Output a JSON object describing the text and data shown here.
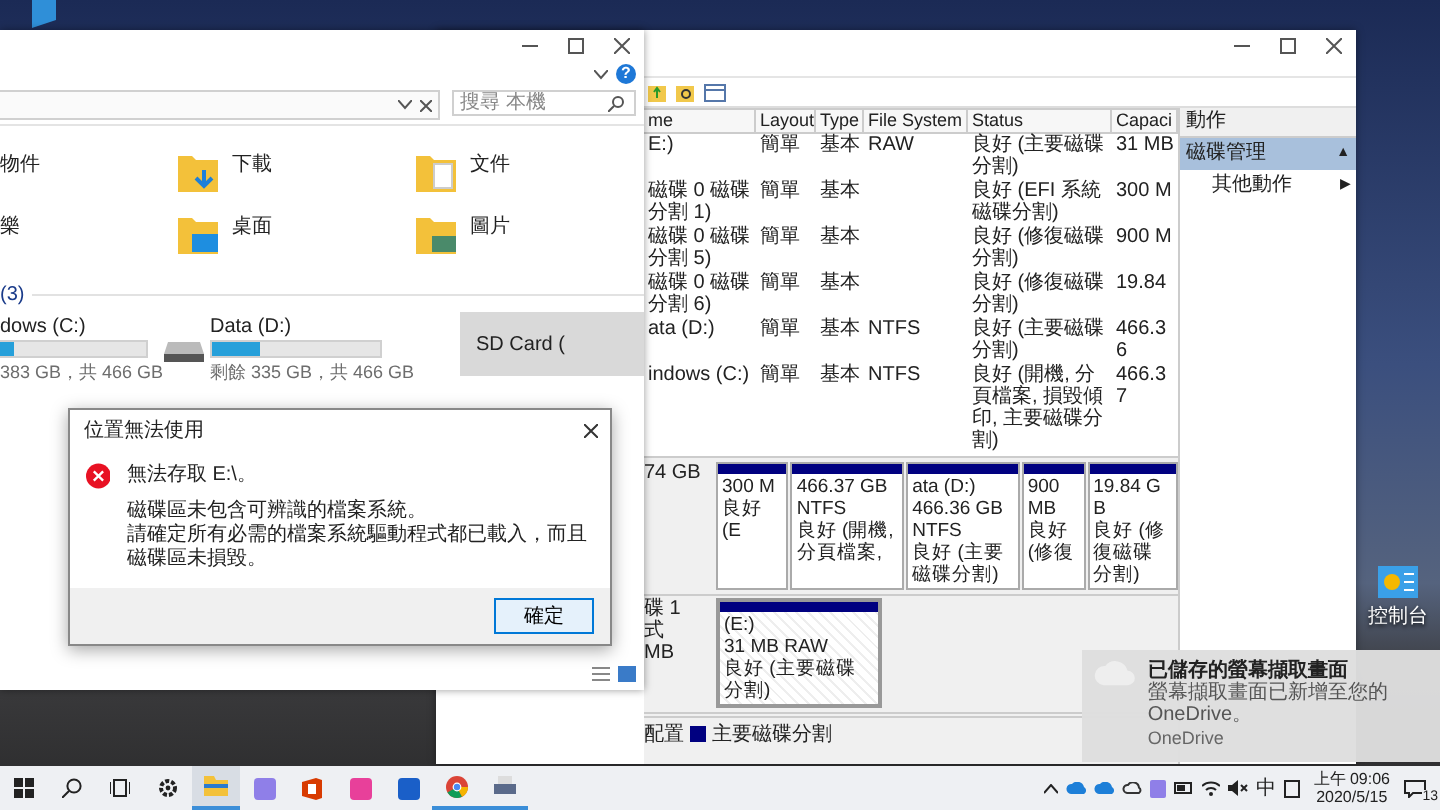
{
  "explorer": {
    "search": {
      "placeholder": "搜尋 本機"
    },
    "help": "?",
    "folders": [
      {
        "label": "物件",
        "kind": "cut"
      },
      {
        "label": "下載",
        "kind": "download"
      },
      {
        "label": "文件",
        "kind": "document"
      },
      {
        "label": "樂",
        "kind": "cut"
      },
      {
        "label": "桌面",
        "kind": "desktop"
      },
      {
        "label": "圖片",
        "kind": "pictures"
      }
    ],
    "section": "(3)",
    "drives": [
      {
        "label": "dows (C:)",
        "level": 0.18,
        "detail": "383 GB，共 466 GB",
        "selected": false,
        "kind": "cut"
      },
      {
        "label": "Data (D:)",
        "level": 0.28,
        "detail": "剩餘 335 GB，共 466 GB",
        "selected": false,
        "kind": "disk"
      },
      {
        "label": "SD Card (",
        "selected": true,
        "kind": "none"
      }
    ]
  },
  "disk_management": {
    "columns": [
      "me",
      "Layout",
      "Type",
      "File System",
      "Status",
      "Capaci"
    ],
    "rows": [
      [
        "E:)",
        "簡單",
        "基本",
        "RAW",
        "良好 (主要磁碟分割)",
        "31 MB"
      ],
      [
        "磁碟 0 磁碟分割 1)",
        "簡單",
        "基本",
        "",
        "良好 (EFI 系統磁碟分割)",
        "300 M"
      ],
      [
        "磁碟 0 磁碟分割 5)",
        "簡單",
        "基本",
        "",
        "良好 (修復磁碟分割)",
        "900 M"
      ],
      [
        "磁碟 0 磁碟分割 6)",
        "簡單",
        "基本",
        "",
        "良好 (修復磁碟分割)",
        "19.84"
      ],
      [
        "ata (D:)",
        "簡單",
        "基本",
        "NTFS",
        "良好 (主要磁碟分割)",
        "466.36"
      ],
      [
        "indows (C:)",
        "簡單",
        "基本",
        "NTFS",
        "良好 (開機, 分頁檔案, 損毀傾印, 主要磁碟分割)",
        "466.37"
      ]
    ],
    "disks": [
      {
        "labels": [
          "74 GB"
        ],
        "partitions": [
          {
            "size": "300 M",
            "status": "良好 (E",
            "selected": false
          },
          {
            "size": "466.37 GB NTFS",
            "status": "良好 (開機, 分頁檔案,",
            "selected": false
          },
          {
            "name": "ata (D:)",
            "size": "466.36 GB NTFS",
            "status": "良好 (主要磁碟分割)",
            "selected": false
          },
          {
            "size": "900 MB",
            "status": "良好 (修復",
            "selected": false
          },
          {
            "size": "19.84 GB",
            "status": "良好 (修復磁碟分割)",
            "selected": false
          }
        ]
      },
      {
        "labels": [
          "碟 1",
          "式",
          "MB"
        ],
        "partitions": [
          {
            "name": "(E:)",
            "size": "31 MB RAW",
            "status": "良好 (主要磁碟分割)",
            "selected": true
          }
        ]
      }
    ],
    "legend": [
      {
        "label": "配置"
      },
      {
        "label": "主要磁碟分割",
        "color": "#000080"
      }
    ],
    "actions": {
      "title": "動作",
      "items": [
        {
          "label": "磁碟管理",
          "arrow": "▲",
          "selected": true
        },
        {
          "label": "其他動作",
          "arrow": "▶",
          "selected": false
        }
      ]
    }
  },
  "dialog": {
    "title": "位置無法使用",
    "heading": "無法存取 E:\\。",
    "message": [
      "磁碟區未包含可辨識的檔案系統。",
      "請確定所有必需的檔案系統驅動程式都已載入，而且磁碟區未損毀。"
    ],
    "button": "確定"
  },
  "desktop_icon": {
    "label": "控制台"
  },
  "notification": {
    "title": "已儲存的螢幕擷取畫面",
    "body": "螢幕擷取畫面已新增至您的 OneDrive。",
    "source": "OneDrive"
  },
  "taskbar": {
    "apps": [
      {
        "kind": "start",
        "selected": false,
        "running": false
      },
      {
        "kind": "search",
        "selected": false,
        "running": false
      },
      {
        "kind": "task-view",
        "selected": false,
        "running": false
      },
      {
        "kind": "settings",
        "selected": false,
        "running": false
      },
      {
        "kind": "folder",
        "selected": true,
        "running": true
      },
      {
        "kind": "tile",
        "color": "#8f7fe8",
        "selected": false,
        "running": false
      },
      {
        "kind": "office",
        "selected": false,
        "running": false
      },
      {
        "kind": "tile",
        "color": "#e8409a",
        "selected": false,
        "running": false
      },
      {
        "kind": "tile",
        "color": "#1a5fc8",
        "selected": false,
        "running": false
      },
      {
        "kind": "chrome",
        "selected": false,
        "running": true
      },
      {
        "kind": "printer",
        "selected": false,
        "running": true
      }
    ],
    "ime": "中",
    "time": "上午 09:06",
    "date": "2020/5/15",
    "notifications": "13"
  }
}
